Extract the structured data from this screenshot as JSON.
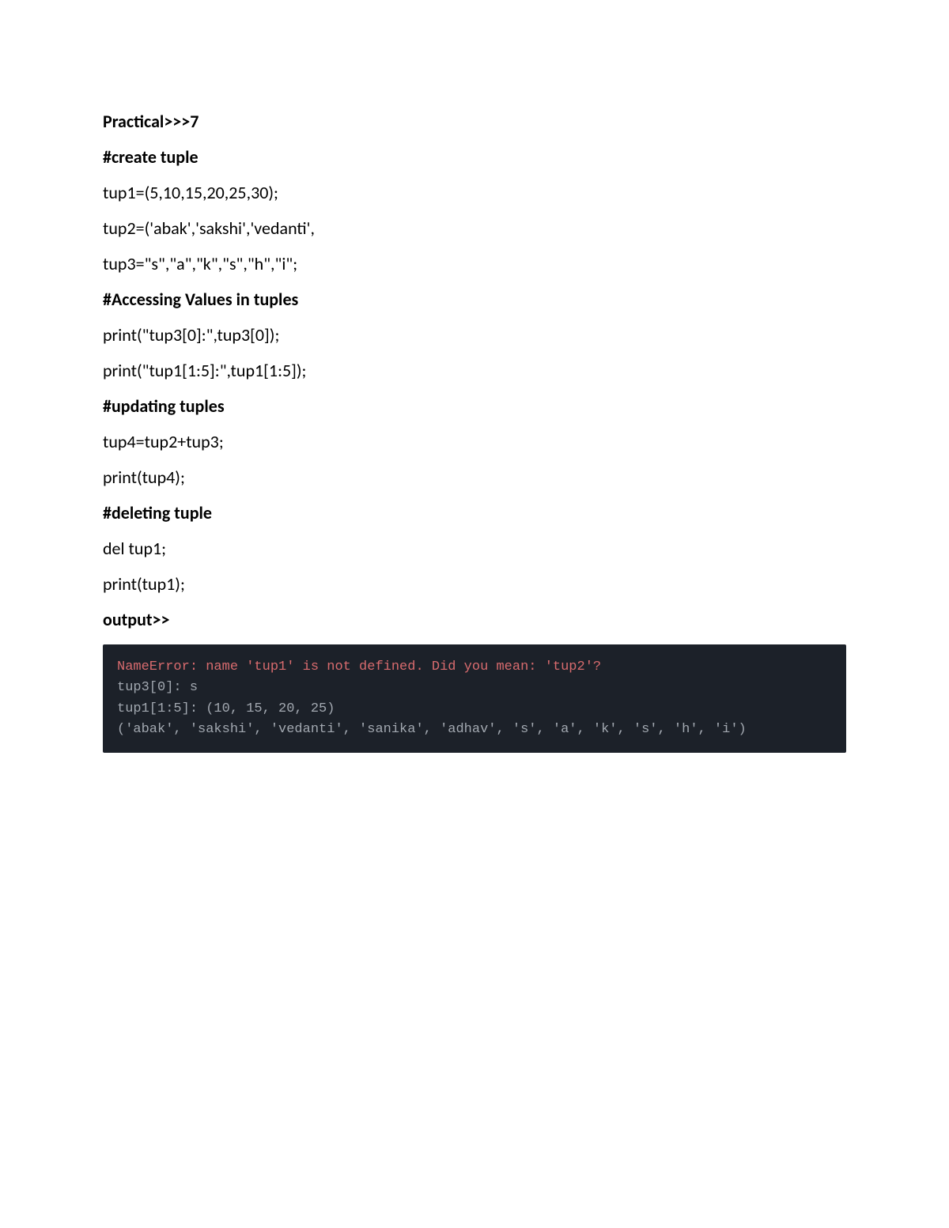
{
  "title": "Practical>>>7",
  "lines": [
    {
      "text": "#create tuple",
      "bold": true
    },
    {
      "text": "tup1=(5,10,15,20,25,30);",
      "bold": false
    },
    {
      "text": "tup2=('abak','sakshi','vedanti',",
      "bold": false
    },
    {
      "text": "tup3=\"s\",\"a\",\"k\",\"s\",\"h\",\"i\";",
      "bold": false
    },
    {
      "text": "#Accessing Values in tuples",
      "bold": true
    },
    {
      "text": "print(\"tup3[0]:\",tup3[0]);",
      "bold": false
    },
    {
      "text": "print(\"tup1[1:5]:\",tup1[1:5]);",
      "bold": false
    },
    {
      "text": "#updating tuples",
      "bold": true
    },
    {
      "text": "tup4=tup2+tup3;",
      "bold": false
    },
    {
      "text": "print(tup4);",
      "bold": false
    },
    {
      "text": "#deleting tuple",
      "bold": true
    },
    {
      "text": "del tup1;",
      "bold": false
    },
    {
      "text": "print(tup1);",
      "bold": false
    }
  ],
  "output_heading": "output>>",
  "console": {
    "error": "NameError: name 'tup1' is not defined. Did you mean: 'tup2'?",
    "out1": "tup3[0]: s",
    "out2": "tup1[1:5]: (10, 15, 20, 25)",
    "out3": "('abak', 'sakshi', 'vedanti', 'sanika', 'adhav', 's', 'a', 'k', 's', 'h', 'i')"
  }
}
